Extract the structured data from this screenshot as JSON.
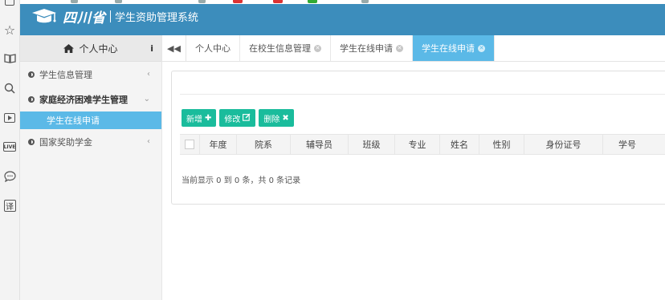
{
  "browser_toolbar": {
    "icons": [
      "window-icon",
      "star-icon",
      "book-icon",
      "search-icon",
      "video-icon",
      "live-icon",
      "chat-icon",
      "translate-icon"
    ],
    "live_label": "LIVE",
    "translate_label": "译"
  },
  "header": {
    "province_logo": "四川省",
    "system_name": "学生资助管理系统",
    "color": "#3c8dbc"
  },
  "sidebar": {
    "title": "个人中心",
    "info_label": "i",
    "items": [
      {
        "label": "学生信息管理",
        "expanded": false
      },
      {
        "label": "家庭经济困难学生管理",
        "expanded": true,
        "children": [
          {
            "label": "学生在线申请",
            "active": true
          }
        ]
      },
      {
        "label": "国家奖助学金",
        "expanded": false
      }
    ]
  },
  "tabs": {
    "back_icon": "double-chevron-left-icon",
    "items": [
      {
        "label": "个人中心",
        "closable": false,
        "active": false
      },
      {
        "label": "在校生信息管理",
        "closable": true,
        "active": false
      },
      {
        "label": "学生在线申请",
        "closable": true,
        "active": false
      },
      {
        "label": "学生在线申请",
        "closable": true,
        "active": true
      }
    ]
  },
  "toolbar": {
    "add_label": "新增",
    "edit_label": "修改",
    "delete_label": "删除",
    "button_color": "#1abc9c"
  },
  "table": {
    "columns": [
      "年度",
      "院系",
      "辅导员",
      "班级",
      "专业",
      "姓名",
      "性别",
      "身份证号",
      "学号"
    ],
    "rows": []
  },
  "pagination": {
    "summary": "当前显示 0 到 0 条，共 0 条记录"
  },
  "accent_color": "#5bb9e7"
}
